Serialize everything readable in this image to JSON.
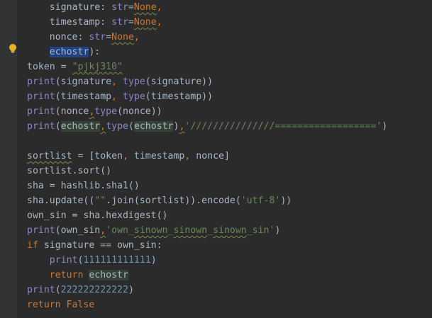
{
  "editor": {
    "language": "python",
    "colors": {
      "background": "#2b2b2b",
      "keyword": "#cc7832",
      "builtin": "#8888c6",
      "string": "#6a8759",
      "number": "#6897bb",
      "text": "#a9b7c6",
      "selection": "#214283"
    },
    "gutter_icon": "lightbulb-icon",
    "lines": [
      {
        "indent": "    ",
        "tokens": [
          {
            "t": "signature",
            "c": ""
          },
          {
            "t": ": ",
            "c": ""
          },
          {
            "t": "str",
            "c": "fn"
          },
          {
            "t": "=",
            "c": ""
          },
          {
            "t": "None",
            "c": "kw sq"
          },
          {
            "t": ",",
            "c": "kw"
          }
        ]
      },
      {
        "indent": "    ",
        "tokens": [
          {
            "t": "timestamp",
            "c": ""
          },
          {
            "t": ": ",
            "c": ""
          },
          {
            "t": "str",
            "c": "fn"
          },
          {
            "t": "=",
            "c": ""
          },
          {
            "t": "None",
            "c": "kw sq"
          },
          {
            "t": ",",
            "c": "kw"
          }
        ]
      },
      {
        "indent": "    ",
        "tokens": [
          {
            "t": "nonce",
            "c": ""
          },
          {
            "t": ": ",
            "c": ""
          },
          {
            "t": "str",
            "c": "fn"
          },
          {
            "t": "=",
            "c": ""
          },
          {
            "t": "None",
            "c": "kw sq"
          },
          {
            "t": ",",
            "c": "kw"
          }
        ]
      },
      {
        "indent": "    ",
        "tokens": [
          {
            "t": "echostr",
            "c": "hl"
          },
          {
            "t": "):",
            "c": ""
          }
        ]
      },
      {
        "indent": "",
        "tokens": [
          {
            "t": "token = ",
            "c": ""
          },
          {
            "t": "\"pjkj310\"",
            "c": "str sq"
          }
        ]
      },
      {
        "indent": "",
        "tokens": [
          {
            "t": "print",
            "c": "fn"
          },
          {
            "t": "(signature",
            "c": ""
          },
          {
            "t": ", ",
            "c": "kw"
          },
          {
            "t": "type",
            "c": "fn"
          },
          {
            "t": "(signature))",
            "c": ""
          }
        ]
      },
      {
        "indent": "",
        "tokens": [
          {
            "t": "print",
            "c": "fn"
          },
          {
            "t": "(timestamp",
            "c": ""
          },
          {
            "t": ", ",
            "c": "kw"
          },
          {
            "t": "type",
            "c": "fn"
          },
          {
            "t": "(timestamp))",
            "c": ""
          }
        ]
      },
      {
        "indent": "",
        "tokens": [
          {
            "t": "print",
            "c": "fn"
          },
          {
            "t": "(nonce",
            "c": ""
          },
          {
            "t": ",",
            "c": "kw sq"
          },
          {
            "t": "type",
            "c": "fn"
          },
          {
            "t": "(nonce))",
            "c": ""
          }
        ]
      },
      {
        "indent": "",
        "tokens": [
          {
            "t": "print",
            "c": "fn"
          },
          {
            "t": "(",
            "c": ""
          },
          {
            "t": "echostr",
            "c": "ref"
          },
          {
            "t": ",",
            "c": "kw sq"
          },
          {
            "t": "type",
            "c": "fn"
          },
          {
            "t": "(",
            "c": ""
          },
          {
            "t": "echostr",
            "c": "ref"
          },
          {
            "t": ")",
            "c": ""
          },
          {
            "t": ",",
            "c": "kw sq"
          },
          {
            "t": "'///////////////=================='",
            "c": "str"
          },
          {
            "t": ")",
            "c": ""
          }
        ]
      },
      {
        "indent": "",
        "tokens": []
      },
      {
        "indent": "",
        "tokens": [
          {
            "t": "sortlist",
            "c": "sq"
          },
          {
            "t": " = [token",
            "c": ""
          },
          {
            "t": ", ",
            "c": "kw"
          },
          {
            "t": "timestamp",
            "c": ""
          },
          {
            "t": ", ",
            "c": "kw"
          },
          {
            "t": "nonce]",
            "c": ""
          }
        ]
      },
      {
        "indent": "",
        "tokens": [
          {
            "t": "sortlist.sort()",
            "c": ""
          }
        ]
      },
      {
        "indent": "",
        "tokens": [
          {
            "t": "sha = hashlib.sha1()",
            "c": ""
          }
        ]
      },
      {
        "indent": "",
        "tokens": [
          {
            "t": "sha.update((",
            "c": ""
          },
          {
            "t": "\"\"",
            "c": "str"
          },
          {
            "t": ".join(sortlist)).encode(",
            "c": ""
          },
          {
            "t": "'utf-8'",
            "c": "str"
          },
          {
            "t": "))",
            "c": ""
          }
        ]
      },
      {
        "indent": "",
        "tokens": [
          {
            "t": "own_sin = sha.hexdigest()",
            "c": ""
          }
        ]
      },
      {
        "indent": "",
        "tokens": [
          {
            "t": "print",
            "c": "fn"
          },
          {
            "t": "(own_sin",
            "c": ""
          },
          {
            "t": ",",
            "c": "kw sq"
          },
          {
            "t": "'own_",
            "c": "str"
          },
          {
            "t": "sinown",
            "c": "str sq"
          },
          {
            "t": "_",
            "c": "str"
          },
          {
            "t": "sinown",
            "c": "str sq"
          },
          {
            "t": "_",
            "c": "str"
          },
          {
            "t": "sinown",
            "c": "str sq"
          },
          {
            "t": "_sin'",
            "c": "str"
          },
          {
            "t": ")",
            "c": ""
          }
        ]
      },
      {
        "indent": "",
        "tokens": [
          {
            "t": "if ",
            "c": "kw"
          },
          {
            "t": "signature == own_sin:",
            "c": ""
          }
        ]
      },
      {
        "indent": "    ",
        "tokens": [
          {
            "t": "print",
            "c": "fn"
          },
          {
            "t": "(",
            "c": ""
          },
          {
            "t": "111111111111",
            "c": "num"
          },
          {
            "t": ")",
            "c": ""
          }
        ]
      },
      {
        "indent": "    ",
        "tokens": [
          {
            "t": "return ",
            "c": "kw"
          },
          {
            "t": "echostr",
            "c": "ref"
          }
        ]
      },
      {
        "indent": "",
        "tokens": [
          {
            "t": "print",
            "c": "fn"
          },
          {
            "t": "(",
            "c": ""
          },
          {
            "t": "222222222222",
            "c": "num"
          },
          {
            "t": ")",
            "c": ""
          }
        ]
      },
      {
        "indent": "",
        "tokens": [
          {
            "t": "return ",
            "c": "kw"
          },
          {
            "t": "False",
            "c": "kw"
          }
        ]
      }
    ]
  }
}
